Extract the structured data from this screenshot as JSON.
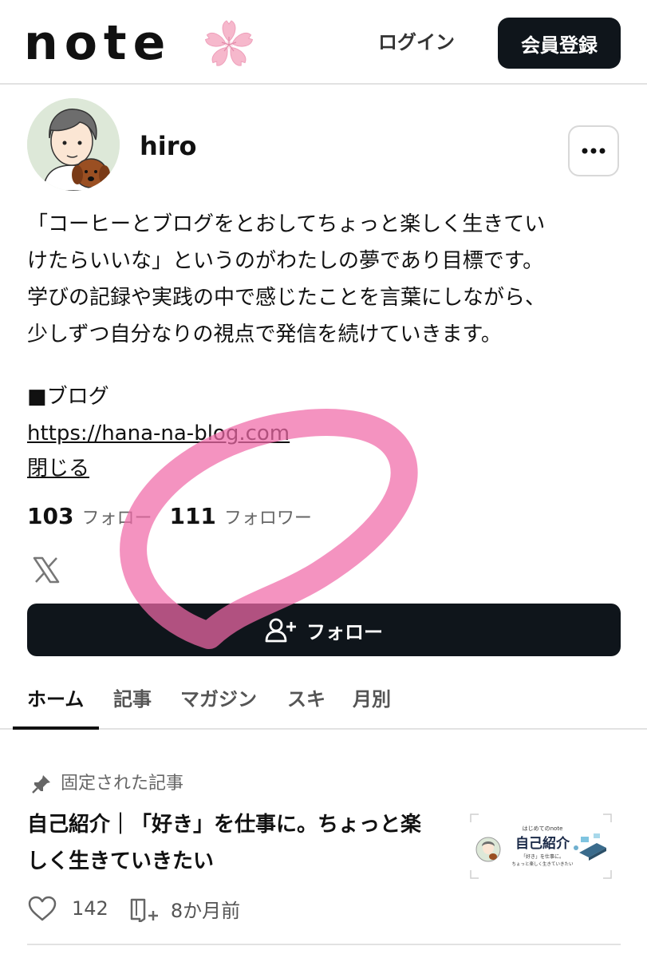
{
  "header": {
    "logo": "note",
    "login_label": "ログイン",
    "signup_label": "会員登録"
  },
  "profile": {
    "name": "hiro",
    "bio": [
      "「コーヒーとブログをとおしてちょっと楽しく生きてい",
      "けたらいいな」というのがわたしの夢であり目標です。",
      "学びの記録や実践の中で感じたことを言葉にしながら、",
      "少しずつ自分なりの視点で発信を続けていきます。"
    ],
    "blog_heading": "■ブログ",
    "blog_url": "https://hana-na-blog.com",
    "close_label": "閉じる",
    "follow_count": "103",
    "follow_label": "フォロー",
    "follower_count": "111",
    "follower_label": "フォロワー",
    "follow_button_label": "フォロー"
  },
  "tabs": [
    {
      "label": "ホーム",
      "active": true
    },
    {
      "label": "記事",
      "active": false
    },
    {
      "label": "マガジン",
      "active": false
    },
    {
      "label": "スキ",
      "active": false
    },
    {
      "label": "月別",
      "active": false
    }
  ],
  "article": {
    "pinned_label": "固定された記事",
    "title_line1": "自己紹介｜「好き」を仕事に。ちょっと楽",
    "title_line2": "しく生きていきたい",
    "thumb_small": "はじめてのnote",
    "thumb_title": "自己紹介",
    "thumb_sub1": "「好き」を仕事に。",
    "thumb_sub2": "ちょっと楽しく生きていきたい",
    "likes": "142",
    "time": "8か月前"
  },
  "colors": {
    "dark_button": "#0f151b",
    "highlight": "#f06aa8",
    "sakura": "#f6b8cc"
  },
  "icons": [
    "sakura-icon",
    "more-icon",
    "x-logo-icon",
    "add-user-icon",
    "pin-icon",
    "heart-icon",
    "magazine-add-icon"
  ]
}
